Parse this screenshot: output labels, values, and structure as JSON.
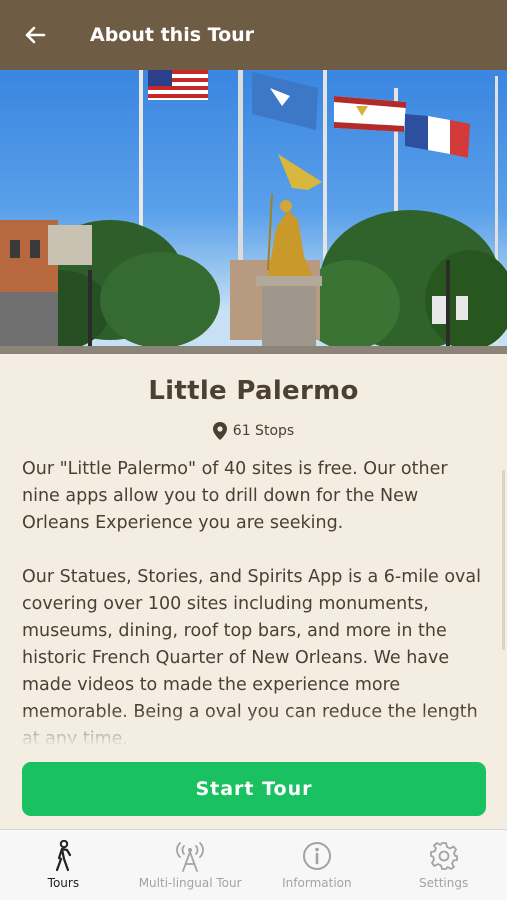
{
  "header": {
    "title": "About this Tour",
    "back_icon": "arrow-left-icon",
    "background": "#6e5c44"
  },
  "hero": {
    "icon": "photo-jeanne-d-arc-statue-with-flags"
  },
  "tour": {
    "name": "Little Palermo",
    "stops": "61 Stops",
    "description": [
      "Our \"Little Palermo\" of 40 sites is free. Our other nine apps allow you to drill down for the New Orleans Experience you are seeking.",
      "Our Statues, Stories, and Spirits App is a 6-mile oval covering over 100 sites including monuments, museums, dining, roof top bars, and more in the historic French Quarter of New Orleans. We have made videos to made the experience more memorable. Being a oval you can reduce the length at any time."
    ]
  },
  "actions": {
    "start_label": "Start Tour",
    "start_color": "#19c160"
  },
  "tabs": [
    {
      "label": "Tours",
      "icon": "walking-person-icon",
      "active": true
    },
    {
      "label": "Multi-lingual Tour",
      "icon": "antenna-icon",
      "active": false
    },
    {
      "label": "Information",
      "icon": "info-icon",
      "active": false
    },
    {
      "label": "Settings",
      "icon": "gear-icon",
      "active": false
    }
  ]
}
